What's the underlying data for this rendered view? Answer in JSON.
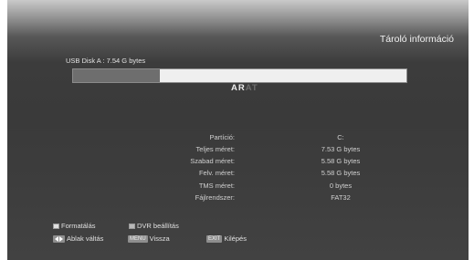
{
  "header": {
    "title": "Tároló információ"
  },
  "disk": {
    "label": "USB Disk A : 7.54 G bytes",
    "used_fraction": 0.26
  },
  "logo": {
    "part1": "AR",
    "part2": "AT"
  },
  "info": [
    {
      "label": "Partíció:",
      "value": "C:"
    },
    {
      "label": "Teljes méret:",
      "value": "7.53 G bytes"
    },
    {
      "label": "Szabad méret:",
      "value": "5.58 G bytes"
    },
    {
      "label": "Felv. méret:",
      "value": "5.58 G bytes"
    },
    {
      "label": "TMS méret:",
      "value": "0 bytes"
    },
    {
      "label": "Fájlrendszer:",
      "value": "FAT32"
    }
  ],
  "keys": {
    "format_label": "Formatálás",
    "format_color": "#e0e0e0",
    "dvr_label": "DVR beállítás",
    "dvr_color": "#b8b8b8",
    "window_label": "Ablak váltás",
    "menu_badge": "MENU",
    "menu_label": "Vissza",
    "exit_badge": "EXIT",
    "exit_label": "Kilépés"
  }
}
